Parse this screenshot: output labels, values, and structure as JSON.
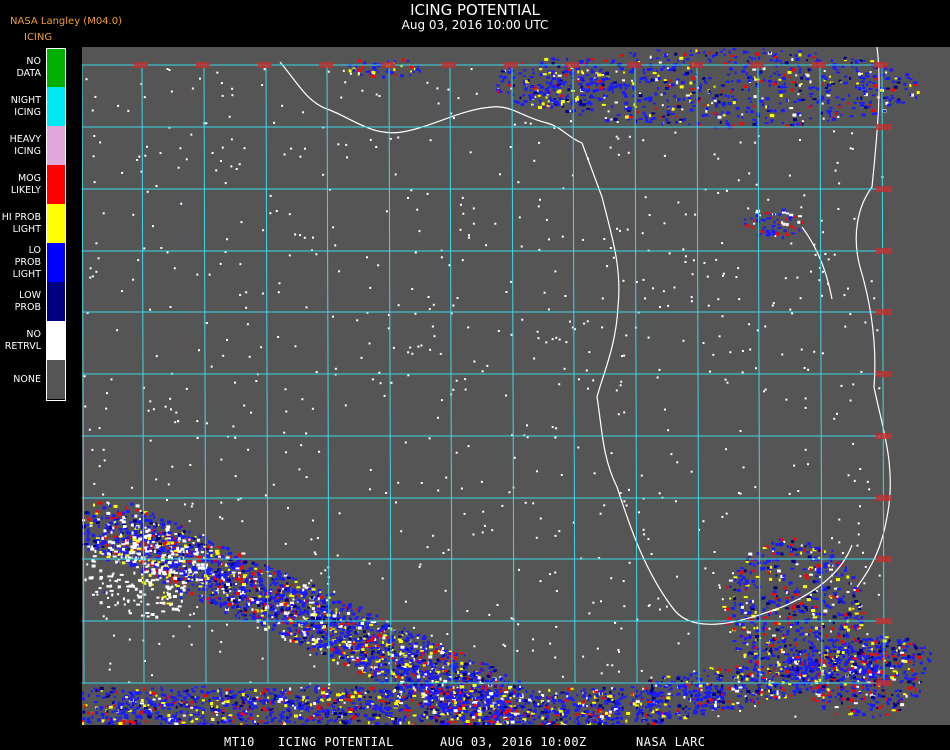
{
  "header": {
    "title": "ICING POTENTIAL",
    "subtitle": "Aug 03, 2016 10:00 UTC",
    "source": "NASA Langley (M04.0)",
    "product": "ICING"
  },
  "legend": [
    {
      "label": "NO DATA",
      "color": "#00b000"
    },
    {
      "label": "NIGHT\nICING",
      "color": "#00e8f0"
    },
    {
      "label": "HEAVY\nICING",
      "color": "#e0a8d8"
    },
    {
      "label": "MOG\nLIKELY",
      "color": "#ff0000"
    },
    {
      "label": "HI PROB\nLIGHT",
      "color": "#ffff00"
    },
    {
      "label": "LO PROB\nLIGHT",
      "color": "#0000ff"
    },
    {
      "label": "LOW\nPROB",
      "color": "#000080"
    },
    {
      "label": "NO\nRETRVL",
      "color": "#ffffff"
    },
    {
      "label": "NONE",
      "color": "#555555"
    }
  ],
  "map": {
    "background_color": "#555555",
    "grid_color": "#40d8e8",
    "coast_color": "#ffffff",
    "label_color": "#c03030"
  },
  "footer": {
    "sat": "MT10",
    "product": "ICING POTENTIAL",
    "datetime": "AUG 03, 2016 10:00Z",
    "org": "NASA LARC"
  }
}
